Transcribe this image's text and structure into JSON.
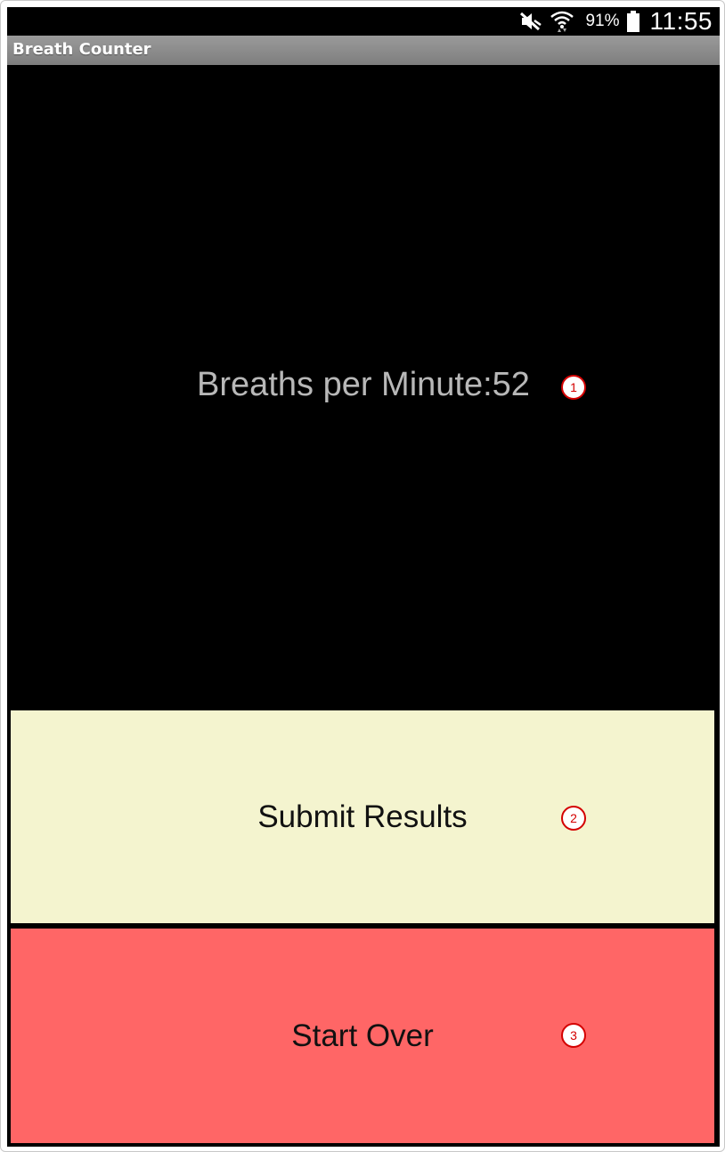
{
  "status_bar": {
    "battery_percent": "91%",
    "time": "11:55",
    "icons": [
      "mute-icon",
      "wifi-icon",
      "battery-icon"
    ]
  },
  "app": {
    "title": "Breath Counter"
  },
  "main": {
    "readout": "Breaths per Minute:52"
  },
  "buttons": {
    "submit_label": "Submit Results",
    "start_over_label": "Start Over"
  },
  "annotations": {
    "marker_1": "1",
    "marker_2": "2",
    "marker_3": "3"
  },
  "colors": {
    "submit_bg": "#f4f4cf",
    "start_over_bg": "#ff6666",
    "readout_text": "#b8b8b8",
    "marker_red": "#d40000"
  }
}
